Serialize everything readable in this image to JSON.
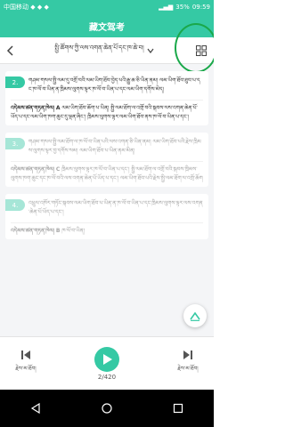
{
  "status_bar": {
    "carrier": "中国移动 ◆ ◆ ◆",
    "signal": "▂▄▆",
    "battery_pct": "35%",
    "time": "09:59"
  },
  "title": "藏文驾考",
  "chapter": {
    "label": "སྤྱི་ཚོགས་ཀྱི་ལས་འགན་ཆེན་པོ་དང་ཁ་ཆེ་བ།"
  },
  "questions": [
    {
      "number": "2.",
      "state": "active",
      "text": "གཤམ་གསལ་སྤྱི་ལམ་དུ་འགྲོ་བའི་ལམ་ཡིག་ཐོབ་བྱེད་པའི་རྒྱུ་ཆ་ཅི་ཡིན་ནམ། ལམ་ཡིག་ཐོབ་ཐུབ་པ་དང་ཁ་ལོ་བ་ཡིན་ན་ཁྲིམས་ལུགས་ལྟར་ཁ་ལོ་བ་ཡིན་པ་དང་ལམ་ཡིག་དགོས་མེད།",
      "answer_label": "འདེམས་ཚན་གཏན་ཁེལ།",
      "answer_value": "A",
      "answer_text": "ལམ་ཡིག་ཐོབ་ཆོག་པ་ཡིན། སྤྱི་ལམ་ཐོག་ལ་འགྲོ་བའི་སྐབས་ལས་འགན་ཆེན་པོ་ཡོད་པ་དང་ལམ་ཡིག་ཁག་ཆུང་དུ་ལྡན་ཞིང་། ཁྲིམས་ལུགས་ལྟར་ལམ་ཡིག་ཐོབ་ནས་ཁ་ལོ་བ་ཡིན་པ་དང་།"
    },
    {
      "number": "3.",
      "state": "faded",
      "text": "གཤམ་གསལ་སྤྱི་ལམ་ཐོག་ལ་ཁ་ལོ་བ་ཡིན་པའི་ལས་འགན་ཅི་ཡིན་ནམ། ལམ་ཡིག་ཐོབ་པའི་རྗེས་ཁྲིམས་ལུགས་ལྟར་བྱ་དགོས་སམ། ལམ་ཡིག་ཐོབ་པ་ཡིན་ནམ་མིན།",
      "answer_label": "འདེམས་ཚན་གཏན་ཁེལ།",
      "answer_value": "C",
      "answer_text": "ཁྲིམས་ལུགས་ལྟར་ཁ་ལོ་བ་ཡིན་པ་དང་། སྤྱི་ལམ་ཐོག་ལ་འགྲོ་བའི་སྐབས་ཁྲིམས་ལུགས་ཁག་ཆུང་དང་ཁ་ལོ་བའི་ལས་འགན་ཆེན་པོ་ཡོད་པ་དང་། ལམ་ཡིག་ཐོབ་པའི་རྗེས་སྤྱི་ལམ་ཐོག་ལ་འགྲོ་ཆོག"
    },
    {
      "number": "4.",
      "state": "faded",
      "text": "འཕྲུལ་འཁོར་གཏོང་སྐབས་ལམ་ཡིག་ཐོབ་པ་ཡིན་ན་ཁ་ལོ་བ་ཡིན་པ་དང་ཁྲིམས་ལུགས་ལྟར་ལས་འགན་ཆེན་པོ་ཡོད་པ་དང་།",
      "answer_label": "འདེམས་ཚན་གཏན་ཁེལ།",
      "answer_value": "B",
      "answer_text": "ཁ་ལོ་བ་ཡིན།"
    }
  ],
  "bottom": {
    "prev_label": "རྗེས་མ་ཐོབ།",
    "counter": "2/420",
    "next_label": "རྗེས་མ་ཐོབ།"
  },
  "colors": {
    "primary": "#35c9a4",
    "faded": "#a6e6d7",
    "annotation_circle": "#1aa84a"
  },
  "icons": {
    "back": "chevron-left-icon",
    "dropdown": "chevron-down-icon",
    "grid": "grid-icon",
    "prev": "skip-previous-icon",
    "play": "play-icon",
    "next": "skip-next-icon",
    "fab": "pen-icon"
  }
}
